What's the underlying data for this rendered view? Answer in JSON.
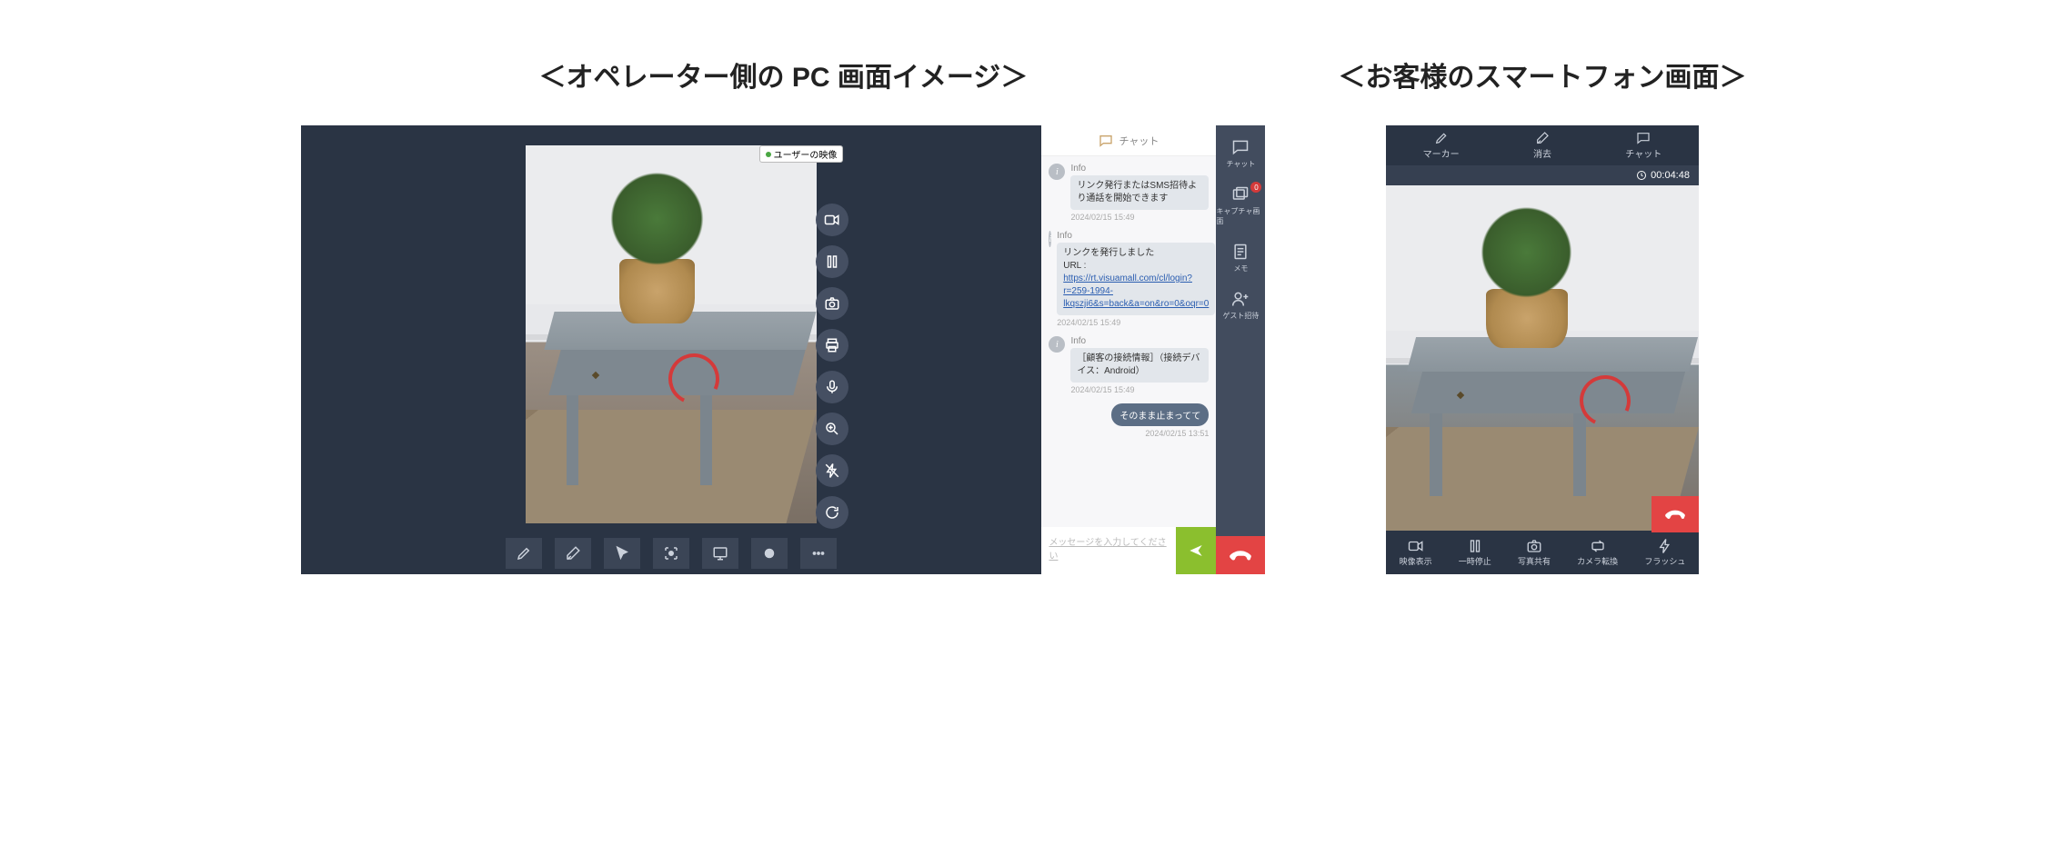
{
  "headings": {
    "operator": "＜オペレーター側の PC 画面イメージ＞",
    "customer": "＜お客様のスマートフォン画面＞"
  },
  "pc": {
    "video_badge": "ユーザーの映像",
    "float_tools": [
      "video-icon",
      "pause-icon",
      "camera-icon",
      "print-icon",
      "mic-icon",
      "zoom-icon",
      "flash-off-icon",
      "refresh-icon"
    ],
    "bottom_tools": [
      "pencil-icon",
      "eraser-icon",
      "cursor-icon",
      "focus-icon",
      "screen-share-icon",
      "circle-icon",
      "more-icon"
    ],
    "side": {
      "items": [
        {
          "label": "チャット",
          "icon": "chat-icon",
          "badge": null
        },
        {
          "label": "キャプチャ画面",
          "icon": "images-icon",
          "badge": "0"
        },
        {
          "label": "メモ",
          "icon": "note-icon",
          "badge": null
        },
        {
          "label": "ゲスト招待",
          "icon": "invite-icon",
          "badge": null
        }
      ]
    },
    "chat": {
      "title": "チャット",
      "messages": [
        {
          "label": "Info",
          "text": "リンク発行またはSMS招待より通話を開始できます",
          "time": "2024/02/15 15:49"
        },
        {
          "label": "Info",
          "text_prefix": "リンクを発行しました\nURL : ",
          "link": "https://rt.visuamall.com/cl/login?r=259-1994-lkqszji6&s=back&a=on&ro=0&oqr=0",
          "time": "2024/02/15 15:49"
        },
        {
          "label": "Info",
          "text": "［顧客の接続情報］（接続デバイス：Android）",
          "time": "2024/02/15 15:49"
        }
      ],
      "my_message": {
        "text": "そのまま止まってて",
        "time": "2024/02/15 13:51"
      },
      "input_placeholder": "メッセージを入力してください"
    },
    "hangup_name": "hangup-button"
  },
  "phone": {
    "top": [
      {
        "label": "マーカー",
        "icon": "pencil-icon"
      },
      {
        "label": "消去",
        "icon": "eraser-icon"
      },
      {
        "label": "チャット",
        "icon": "chat-icon"
      }
    ],
    "timer": "00:04:48",
    "bottom": [
      {
        "label": "映像表示",
        "icon": "video-icon"
      },
      {
        "label": "一時停止",
        "icon": "pause-icon"
      },
      {
        "label": "写真共有",
        "icon": "camera-icon"
      },
      {
        "label": "カメラ転換",
        "icon": "switch-camera-icon"
      },
      {
        "label": "フラッシュ",
        "icon": "flash-icon"
      }
    ]
  }
}
